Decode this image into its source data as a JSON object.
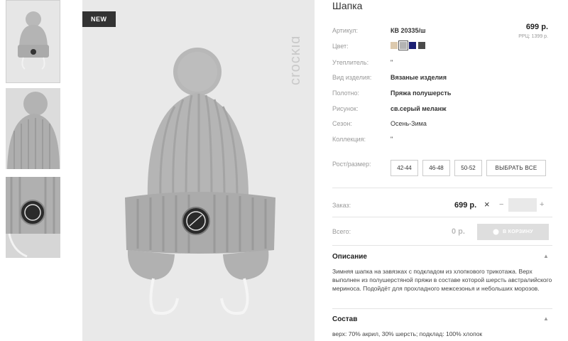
{
  "product": {
    "title": "Шапка",
    "price": "699 р.",
    "rrp": "РРЦ: 1399 р.",
    "badge": "NEW",
    "brand": "crockid"
  },
  "attributes": [
    {
      "label": "Артикул:",
      "value": "КВ 20335/ш"
    },
    {
      "label": "Цвет:",
      "value": ""
    },
    {
      "label": "Утеплитель:",
      "value": "\""
    },
    {
      "label": "Вид изделия:",
      "value": "Вязаные изделия"
    },
    {
      "label": "Полотно:",
      "value": "Пряжа полушерсть"
    },
    {
      "label": "Рисунок:",
      "value": "св.серый меланж"
    },
    {
      "label": "Сезон:",
      "value": "Осень-Зима"
    },
    {
      "label": "Коллекция:",
      "value": "\""
    }
  ],
  "colors": [
    "#dcc9ad",
    "#b3b3b3",
    "#1b1f73",
    "#4a4a4a"
  ],
  "sizes": {
    "label": "Рост/размер:",
    "options": [
      "42-44",
      "46-48",
      "50-52"
    ],
    "select_all": "ВЫБРАТЬ ВСЕ"
  },
  "order": {
    "label": "Заказ:",
    "price": "699 р.",
    "close": "×",
    "minus": "−",
    "plus": "+",
    "qty_value": ""
  },
  "total": {
    "label": "Всего:",
    "price": "0 р.",
    "cart_button": "В КОРЗИНУ"
  },
  "description": {
    "title": "Описание",
    "text": "Зимняя шапка на завязках с подкладом из хлопкового трикотажа. Верх выполнен из полушерстяной пряжи в составе которой шерсть австралийского мериноса. Подойдёт для прохладного межсезонья и небольших морозов."
  },
  "composition": {
    "title": "Состав",
    "text": "верх: 70% акрил, 30% шерсть; подклад: 100% хлопок"
  }
}
